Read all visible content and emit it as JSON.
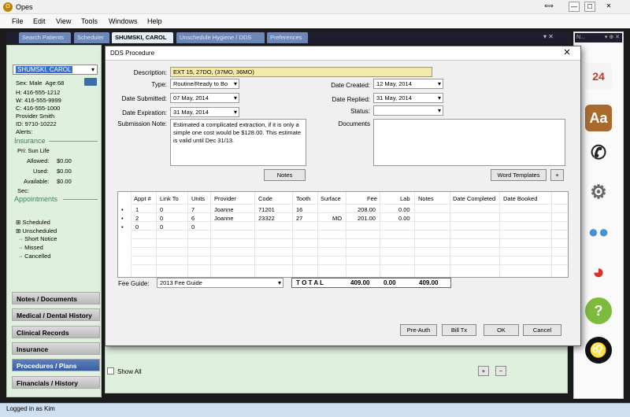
{
  "app": {
    "title": "Opes",
    "icon_letter": "O"
  },
  "window_controls": [
    "⟺",
    "—",
    "☐",
    "✕"
  ],
  "menu": [
    "File",
    "Edit",
    "View",
    "Tools",
    "Windows",
    "Help"
  ],
  "tabs": [
    {
      "label": "Search Patients"
    },
    {
      "label": "Scheduler"
    },
    {
      "label": "SHUMSKI, CAROL"
    },
    {
      "label": "Unschedule Hygiene / DDS"
    },
    {
      "label": "Preferences"
    }
  ],
  "tab_controls": "▾ ✕",
  "right_dock_header": "N...",
  "right_dock_controls": "▾ ⊕ ✕",
  "patient": {
    "name": "SHUMSKI, CAROL",
    "sex_label": "Sex:",
    "sex": "Male",
    "age_label": "Age:",
    "age": "68",
    "home": "H:  416-555-1212",
    "work": "W:  416-555-9999",
    "cell": "C:  416-555-1000",
    "provider": "Provider Smith",
    "id": "ID:  9710-10222",
    "alerts": "Alerts:"
  },
  "insurance": {
    "heading": "Insurance",
    "pri": "Pri:  Sun Life",
    "allowed_label": "Allowed:",
    "allowed": "$0.00",
    "used_label": "Used:",
    "used": "$0.00",
    "available_label": "Available:",
    "available": "$0.00",
    "sec": "Sec:"
  },
  "appointments": {
    "heading": "Appointments",
    "items": [
      "Scheduled",
      "Unscheduled",
      "Short Notice",
      "Missed",
      "Cancelled"
    ]
  },
  "nav_buttons": [
    "Notes / Documents",
    "Medical / Dental History",
    "Clinical Records",
    "Insurance",
    "Procedures / Plans",
    "Financials / History"
  ],
  "show_all": "Show All",
  "status": "Logged in as Kim",
  "dialog": {
    "title": "DDS Procedure",
    "close": "✕",
    "description_label": "Description:",
    "description": "EXT 15, 27DO, (37MO, 36MO)",
    "type_label": "Type:",
    "type": "Routine/Ready to Bo",
    "date_submitted_label": "Date Submitted:",
    "date_submitted": "07 May, 2014",
    "date_expiration_label": "Date Expiration:",
    "date_expiration": "31 May, 2014",
    "submission_note_label": "Submission Note:",
    "submission_note": "Estimated a complicated extraction, if it is only a simple one cost would be $128.00. This estimate is valid until Dec 31/13.",
    "date_created_label": "Date Created:",
    "date_created": "12 May, 2014",
    "date_replied_label": "Date Replied:",
    "date_replied": "31 May, 2014",
    "status_label": "Status:",
    "status": "",
    "documents_label": "Documents",
    "notes_button": "Notes",
    "word_templates_button": "Word Templates",
    "plus_button": "+",
    "grid": {
      "columns": [
        "Appt #",
        "Link To",
        "Units",
        "Provider",
        "Code",
        "Tooth",
        "Surface",
        "Fee",
        "Lab",
        "Notes",
        "Date Completed",
        "Date Booked"
      ],
      "rows": [
        {
          "marker": "•",
          "appt": "1",
          "link": "0",
          "units": "7",
          "provider": "Joanne",
          "code": "71201",
          "tooth": "16",
          "surface": "",
          "fee": "208.00",
          "lab": "0.00"
        },
        {
          "marker": "•",
          "appt": "2",
          "link": "0",
          "units": "6",
          "provider": "Joanne",
          "code": "23322",
          "tooth": "27",
          "surface": "MO",
          "fee": "201.00",
          "lab": "0.00"
        },
        {
          "marker": "•",
          "appt": "0",
          "link": "0",
          "units": "0",
          "provider": "",
          "code": "",
          "tooth": "",
          "surface": "",
          "fee": "",
          "lab": ""
        }
      ]
    },
    "fee_guide_label": "Fee Guide:",
    "fee_guide": "2013 Fee Guide",
    "total_label": "T O T A L",
    "total_fee": "409.00",
    "total_lab": "0.00",
    "total_sum": "409.00",
    "buttons": {
      "pre_auth": "Pre-Auth",
      "bill_tx": "Bill Tx",
      "ok": "OK",
      "cancel": "Cancel"
    }
  },
  "bottom_buttons": {
    "add": "+",
    "remove": "−"
  }
}
